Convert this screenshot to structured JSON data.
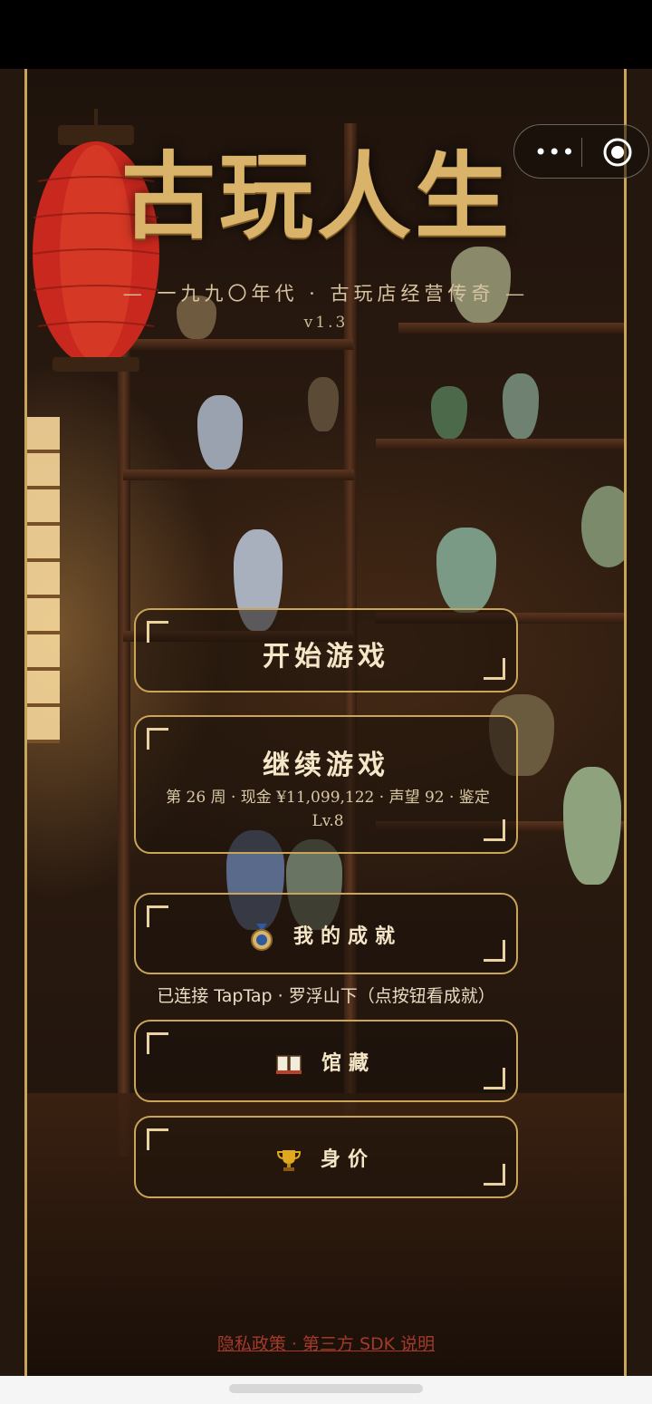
{
  "game": {
    "title": "古玩人生",
    "subtitle": "— 一九九〇年代 · 古玩店经营传奇 —",
    "version": "v1.3"
  },
  "capsule": {
    "more_icon": "more-dots-icon",
    "close_icon": "target-close-icon"
  },
  "menu": {
    "start_label": "开始游戏",
    "continue_label": "继续游戏",
    "continue_sub": "第 26 周 · 现金 ¥11,099,122 · 声望 92 · 鉴定 Lv.8",
    "achievements_label": "我的成就",
    "achievements_icon": "medal-icon",
    "taptap_note": "已连接 TapTap · 罗浮山下（点按钮看成就）",
    "collection_label": "馆藏",
    "collection_icon": "book-icon",
    "worth_label": "身价",
    "worth_icon": "trophy-icon"
  },
  "footer": {
    "privacy_link": "隐私政策 · 第三方 SDK 说明"
  },
  "colors": {
    "gold": "#c9a55a",
    "title_gold": "#d9b36a",
    "link_red": "#a33a2a",
    "lantern_red": "#c8281e"
  }
}
